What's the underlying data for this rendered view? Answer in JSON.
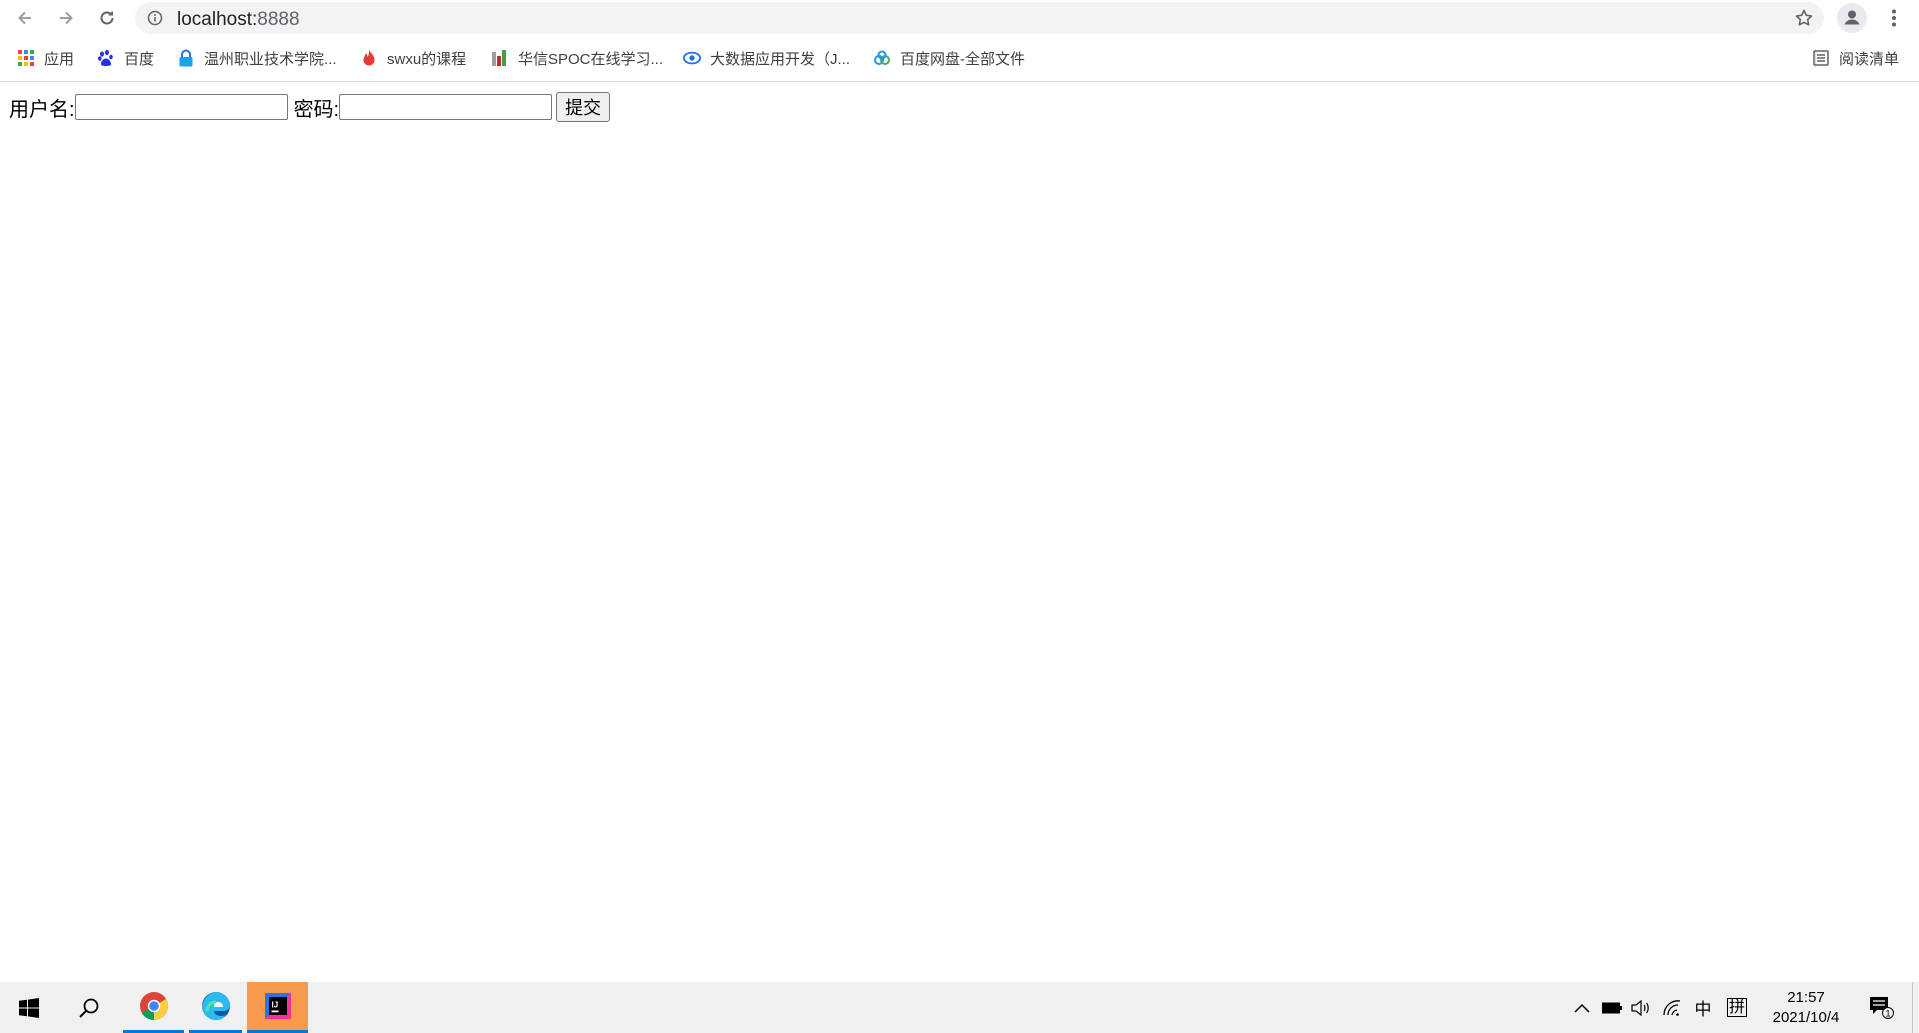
{
  "browser": {
    "url_host": "localhost:",
    "url_port": "8888"
  },
  "bookmarks": [
    {
      "label": "应用",
      "icon": "apps-grid-icon"
    },
    {
      "label": "百度",
      "icon": "baidu-paw-icon"
    },
    {
      "label": "温州职业技术学院...",
      "icon": "lock-icon"
    },
    {
      "label": "swxu的课程",
      "icon": "flame-icon"
    },
    {
      "label": "华信SPOC在线学习...",
      "icon": "spoc-icon"
    },
    {
      "label": "大数据应用开发（J...",
      "icon": "cloud-eye-icon"
    },
    {
      "label": "百度网盘-全部文件",
      "icon": "baidu-netdisk-icon"
    }
  ],
  "reading_list": {
    "label": "阅读清单",
    "icon": "reading-list-icon"
  },
  "form": {
    "username_label": "用户名:",
    "username_value": "",
    "password_label": "密码:",
    "password_value": "",
    "submit_label": "提交"
  },
  "taskbar": {
    "apps": [
      "chrome-icon",
      "edge-icon",
      "intellij-icon"
    ],
    "tray": {
      "ime_lang": "中",
      "ime_mode": "拼",
      "time": "21:57",
      "date": "2021/10/4",
      "notification_count": "1"
    }
  },
  "colors": {
    "taskbar_bg": "#f0f0f0",
    "active_indicator": "#0078d7",
    "intellij_bg": "#f79a4e"
  }
}
